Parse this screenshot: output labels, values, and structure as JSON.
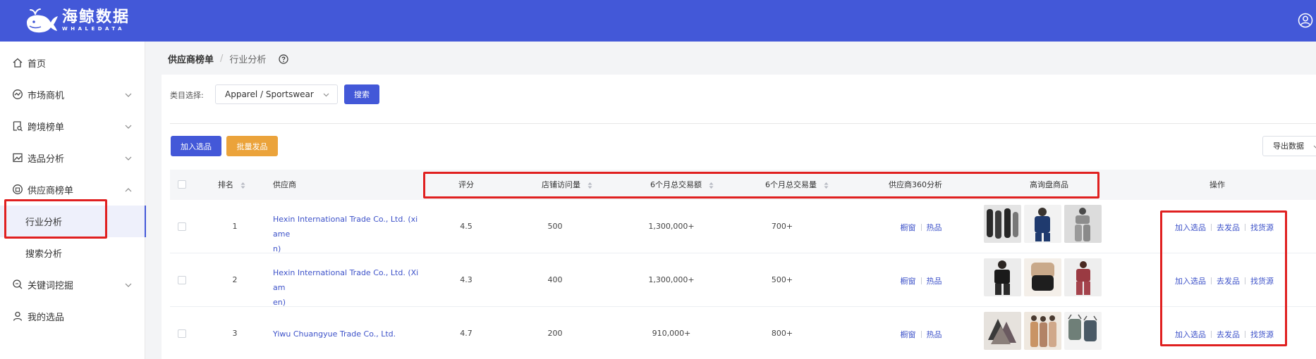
{
  "header": {
    "logo_cn": "海鲸数据",
    "logo_en": "WHALEDATA",
    "brand_color": "#4358d8"
  },
  "sidebar": {
    "items": [
      {
        "label": "首页",
        "icon": "home-icon"
      },
      {
        "label": "市场商机",
        "icon": "trend-icon",
        "expanded": false
      },
      {
        "label": "跨境榜单",
        "icon": "search-doc-icon",
        "expanded": false
      },
      {
        "label": "选品分析",
        "icon": "image-chart-icon",
        "expanded": false
      },
      {
        "label": "供应商榜单",
        "icon": "supplier-icon",
        "expanded": true
      },
      {
        "label": "行业分析",
        "sub": true,
        "active": true
      },
      {
        "label": "搜索分析",
        "sub": true
      },
      {
        "label": "关键词挖掘",
        "icon": "keyword-search-icon",
        "expanded": false
      },
      {
        "label": "我的选品",
        "icon": "user-icon"
      }
    ]
  },
  "breadcrumb": {
    "level1": "供应商榜单",
    "separator": "/",
    "level2": "行业分析"
  },
  "filter": {
    "label": "类目选择:",
    "selected": "Apparel / Sportswear",
    "search_label": "搜索"
  },
  "toolbar": {
    "add_label": "加入选品",
    "batch_label": "批量发品",
    "export_label": "导出数据"
  },
  "table": {
    "columns": {
      "rank": "排名",
      "supplier": "供应商",
      "rating": "评分",
      "visits": "店铺访问量",
      "amount": "6个月总交易额",
      "volume": "6个月总交易量",
      "analysis": "供应商360分析",
      "products": "高询盘商品",
      "actions": "操作"
    },
    "rows": [
      {
        "rank": "1",
        "supplier_line1": "Hexin International Trade Co., Ltd. (xiame",
        "supplier_line2": "n)",
        "rating": "4.5",
        "visits": "500",
        "amount": "1,300,000+",
        "volume": "700+"
      },
      {
        "rank": "2",
        "supplier_line1": "Hexin International Trade Co., Ltd. (Xiam",
        "supplier_line2": "en)",
        "rating": "4.3",
        "visits": "400",
        "amount": "1,300,000+",
        "volume": "500+"
      },
      {
        "rank": "3",
        "supplier_line1": "Yiwu Chuangyue Trade Co., Ltd.",
        "supplier_line2": "",
        "rating": "4.7",
        "visits": "200",
        "amount": "910,000+",
        "volume": "800+"
      }
    ],
    "analysis_links": {
      "window": "橱窗",
      "hot": "热品"
    },
    "action_links": {
      "add": "加入选品",
      "publish": "去发品",
      "source": "找货源"
    }
  }
}
